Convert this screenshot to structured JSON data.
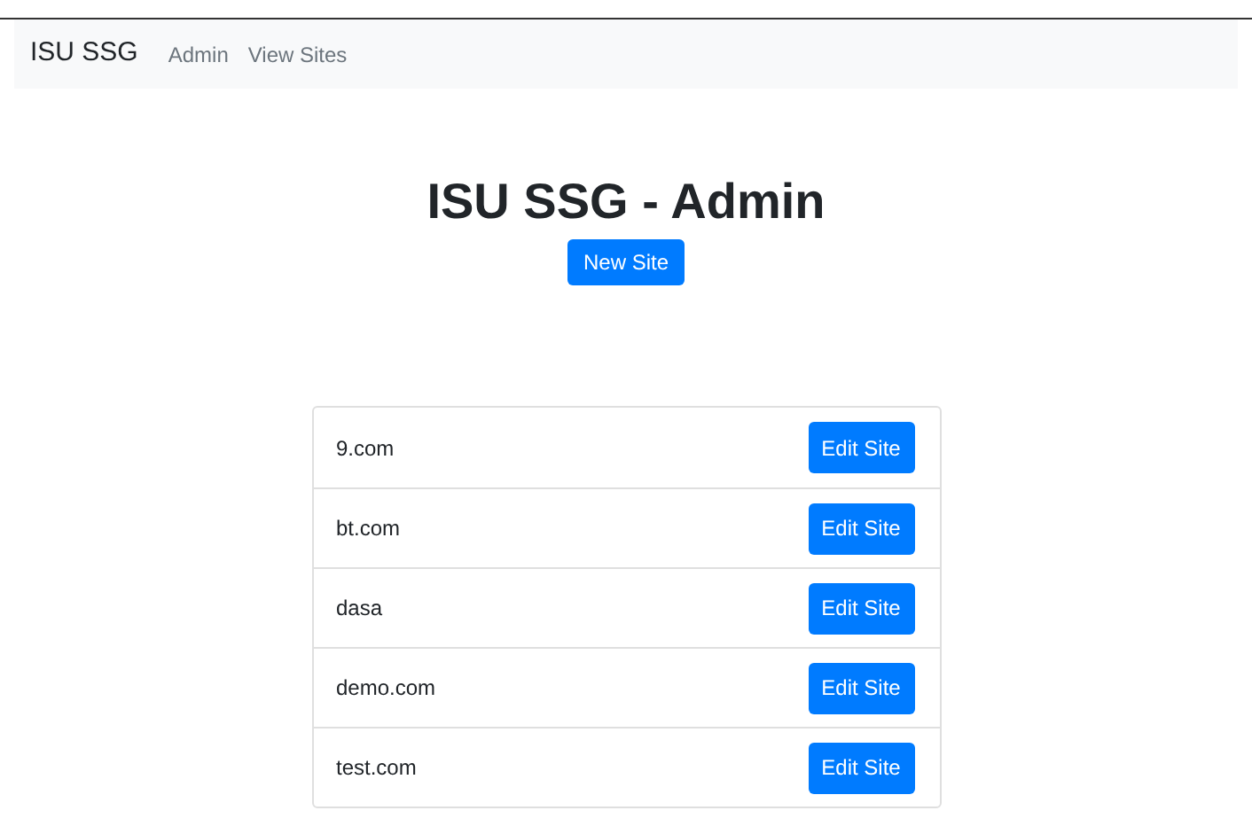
{
  "navbar": {
    "brand": "ISU SSG",
    "links": [
      "Admin",
      "View Sites"
    ]
  },
  "heading": "ISU SSG - Admin",
  "new_button": "New Site",
  "sites": [
    {
      "name": "9.com",
      "button": "Edit Site"
    },
    {
      "name": "bt.com",
      "button": "Edit Site"
    },
    {
      "name": "dasa",
      "button": "Edit Site"
    },
    {
      "name": "demo.com",
      "button": "Edit Site"
    },
    {
      "name": "test.com",
      "button": "Edit Site"
    }
  ]
}
